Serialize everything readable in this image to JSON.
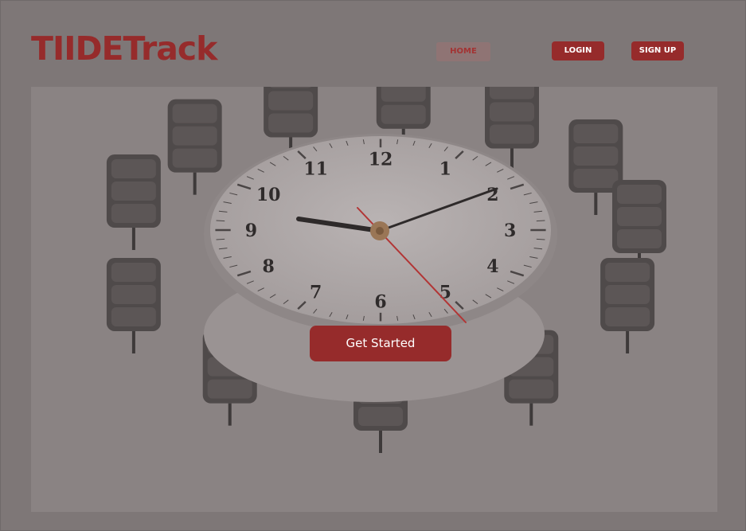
{
  "header": {
    "logo_text": "TIIDETrack",
    "nav": {
      "home_label": "HOME",
      "login_label": "LOGIN",
      "signup_label": "SIGN UP"
    }
  },
  "hero": {
    "image_subject": "round clock table with office chairs",
    "clock_numerals": [
      "12",
      "1",
      "2",
      "3",
      "4",
      "5",
      "6",
      "7",
      "8",
      "9",
      "10",
      "11"
    ],
    "cta_label": "Get Started"
  },
  "colors": {
    "brand": "#962b2b",
    "page_background": "#7e7777",
    "button_text": "#ffffff"
  }
}
